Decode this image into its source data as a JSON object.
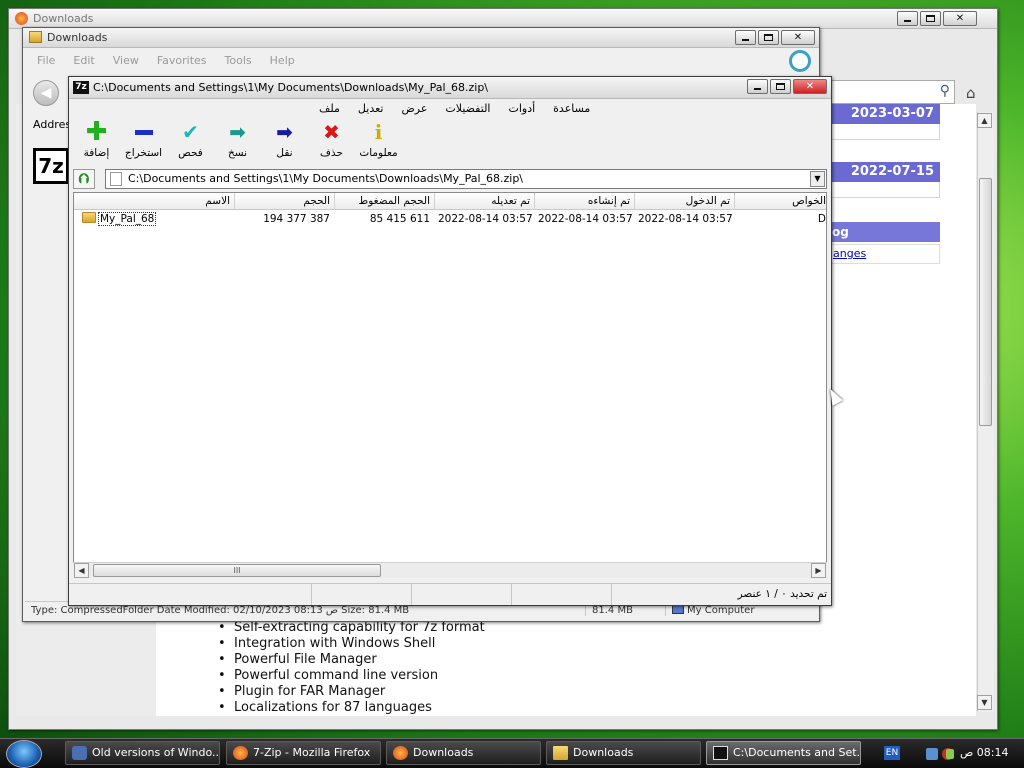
{
  "firefox": {
    "title": "Downloads",
    "dates": [
      "2023-03-07",
      "2022-07-15"
    ],
    "blog_label": "og",
    "changes_link": "anges",
    "features": [
      "Self-extracting capability for 7z format",
      "Integration with Windows Shell",
      "Powerful File Manager",
      "Powerful command line version",
      "Plugin for FAR Manager",
      "Localizations for 87 languages"
    ]
  },
  "explorer": {
    "title": "Downloads",
    "menu": [
      "File",
      "Edit",
      "View",
      "Favorites",
      "Tools",
      "Help"
    ],
    "address_label": "Addres",
    "status_type": "Type: CompressedFolder Date Modified: 02/10/2023 08:13 ص Size: 81.4 MB",
    "status_size": "81.4 MB",
    "status_zone": "My Computer"
  },
  "zip": {
    "title": "C:\\Documents and Settings\\1\\My Documents\\Downloads\\My_Pal_68.zip\\",
    "menu": [
      "ملف",
      "تعديل",
      "عرض",
      "التفضيلات",
      "أدوات",
      "مساعدة"
    ],
    "toolbar": {
      "add": "إضافة",
      "extract": "استخراج",
      "test": "فحص",
      "copy": "نسخ",
      "move": "نقل",
      "delete": "حذف",
      "info": "معلومات"
    },
    "path": "C:\\Documents and Settings\\1\\My Documents\\Downloads\\My_Pal_68.zip\\",
    "columns": {
      "name": "الاسم",
      "size": "الحجم",
      "packed": "الحجم المضغوط",
      "modified": "تم تعديله",
      "created": "تم إنشاءه",
      "accessed": "تم الدخول",
      "attributes": "الخواص"
    },
    "row": {
      "name": "My_Pal_68",
      "size": "194 377 387",
      "packed": "85 415 611",
      "modified": "2022-08-14 03:57",
      "created": "2022-08-14 03:57",
      "accessed": "2022-08-14 03:57",
      "attributes": "D"
    },
    "status": "تم تحديد ٠ / ١ عنصر",
    "scroll_grip": "III"
  },
  "taskbar": {
    "items": [
      "Old versions of Windo...",
      "7-Zip - Mozilla Firefox",
      "Downloads",
      "Downloads",
      "C:\\Documents and Set..."
    ],
    "lang": "EN",
    "clock": "08:14 ص"
  }
}
